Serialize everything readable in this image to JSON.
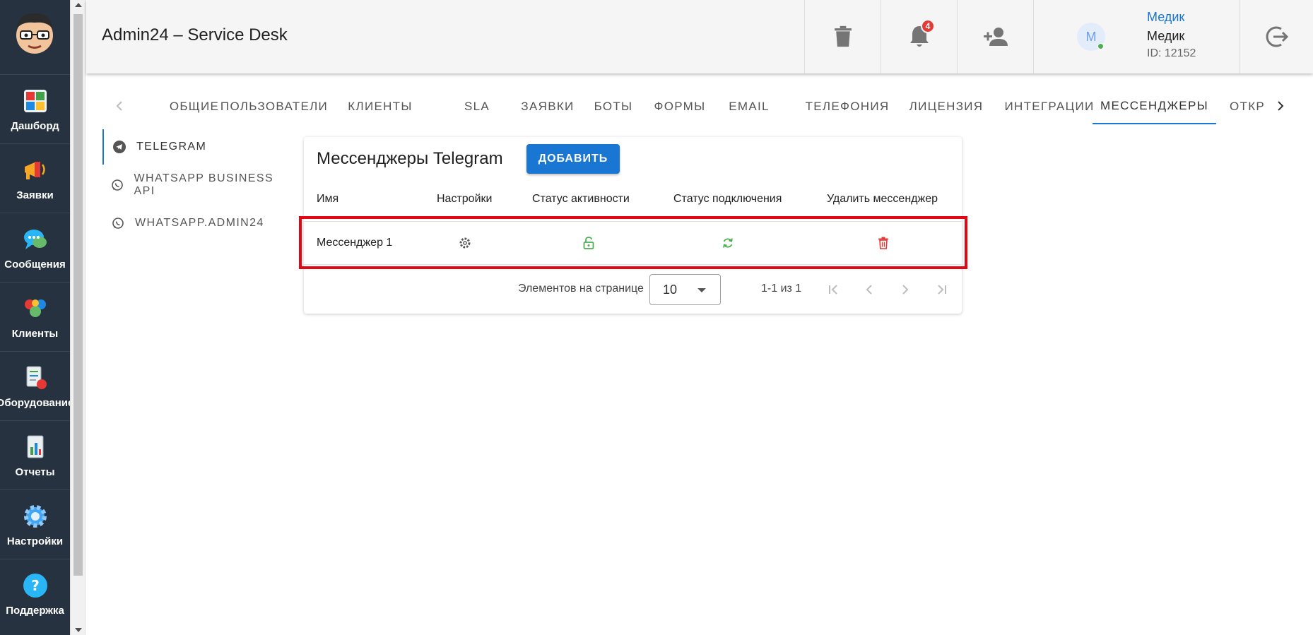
{
  "app": {
    "title": "Admin24 – Service Desk"
  },
  "sidebar": {
    "items": [
      {
        "label": "Дашборд",
        "icon": "dashboard-icon"
      },
      {
        "label": "Заявки",
        "icon": "megaphone-icon"
      },
      {
        "label": "Сообщения",
        "icon": "chat-icon"
      },
      {
        "label": "Клиенты",
        "icon": "clients-icon"
      },
      {
        "label": "Оборудование",
        "icon": "equipment-icon"
      },
      {
        "label": "Отчеты",
        "icon": "reports-icon"
      },
      {
        "label": "Настройки",
        "icon": "gear-icon"
      },
      {
        "label": "Поддержка",
        "icon": "help-icon"
      }
    ]
  },
  "header": {
    "notifications_count": "4",
    "avatar_initial": "M",
    "user_link": "Медик",
    "user_name": "Медик",
    "user_id": "ID: 12152"
  },
  "tabs": [
    {
      "label": "ОБЩИЕ"
    },
    {
      "label": "ПОЛЬЗОВАТЕЛИ"
    },
    {
      "label": "КЛИЕНТЫ"
    },
    {
      "label": "SLA"
    },
    {
      "label": "ЗАЯВКИ"
    },
    {
      "label": "БОТЫ"
    },
    {
      "label": "ФОРМЫ"
    },
    {
      "label": "EMAIL"
    },
    {
      "label": "ТЕЛЕФОНИЯ"
    },
    {
      "label": "ЛИЦЕНЗИЯ"
    },
    {
      "label": "ИНТЕГРАЦИИ"
    },
    {
      "label": "МЕССЕНДЖЕРЫ",
      "active": true
    },
    {
      "label": "ОТКР"
    }
  ],
  "subnav": [
    {
      "label": "TELEGRAM",
      "active": true
    },
    {
      "label": "WHATSAPP BUSINESS API"
    },
    {
      "label": "WHATSAPP.ADMIN24"
    }
  ],
  "card": {
    "title": "Мессенджеры Telegram",
    "add_label": "ДОБАВИТЬ",
    "columns": [
      "Имя",
      "Настройки",
      "Статус активности",
      "Статус подключения",
      "Удалить мессенджер"
    ],
    "rows": [
      {
        "name": "Мессенджер 1",
        "settings_icon": "gear-icon",
        "activity_icon": "unlock-icon",
        "connection_icon": "sync-icon",
        "delete_icon": "trash-icon"
      }
    ],
    "pagination": {
      "per_page_label": "Элементов на странице",
      "per_page": "10",
      "range": "1-1 из 1"
    }
  },
  "colors": {
    "accent": "#1976d2",
    "sidebar_bg": "#26323f",
    "success": "#4caf50",
    "danger": "#e53935",
    "highlight": "#e30613"
  }
}
